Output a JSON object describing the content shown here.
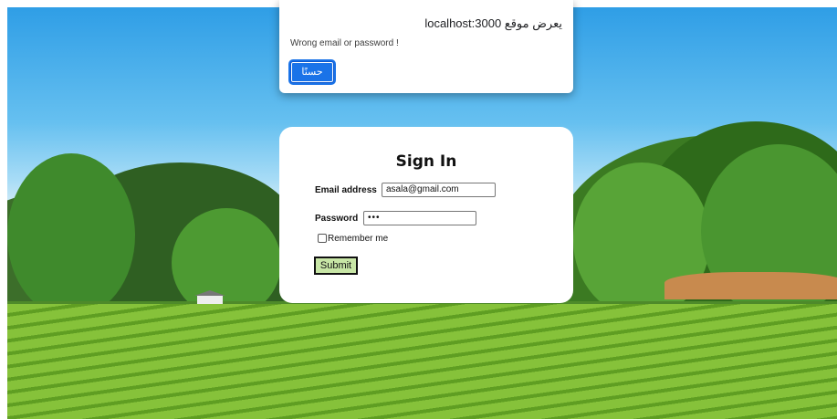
{
  "alert": {
    "title": "يعرض موقع localhost:3000",
    "message": "Wrong email or password !",
    "ok_label": "حسنًا"
  },
  "signin": {
    "title": "Sign In",
    "email_label": "Email address",
    "email_value": "asala@gmail.com",
    "password_label": "Password",
    "password_value": "•••",
    "remember_label": "Remember me",
    "remember_checked": false,
    "submit_label": "Submit"
  },
  "colors": {
    "accent": "#1a73e8",
    "submit_bg": "#c8e6a6"
  }
}
